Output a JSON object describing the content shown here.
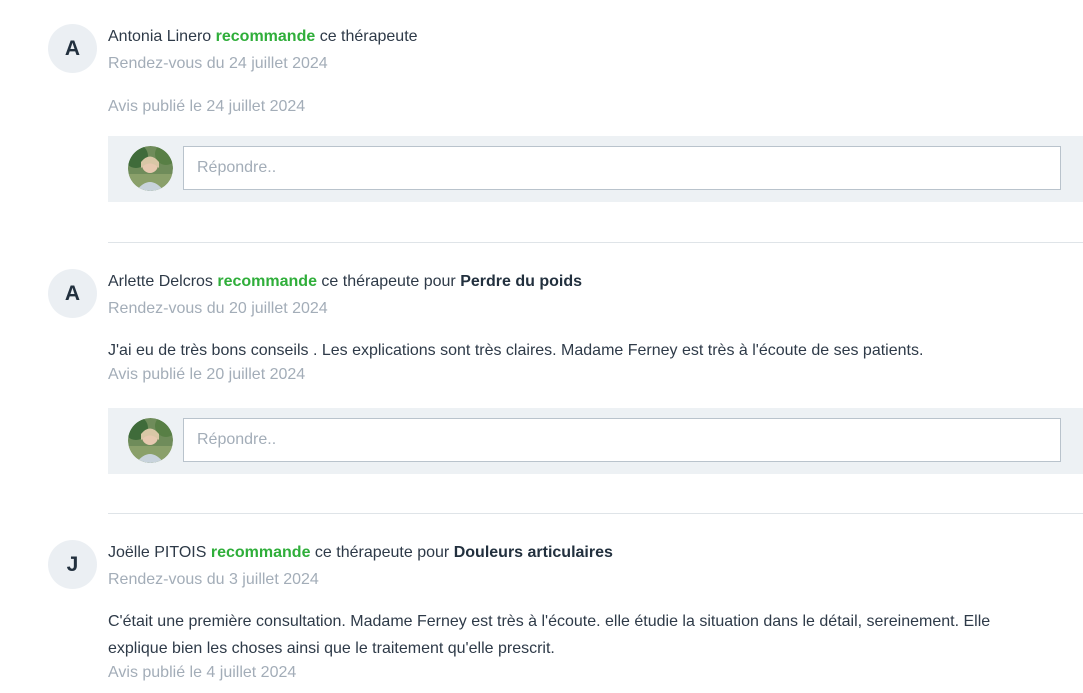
{
  "reviews": [
    {
      "initial": "A",
      "author": "Antonia Linero",
      "recommend_word": "recommande",
      "therapist_text": "ce thérapeute",
      "for_word": "",
      "reason": "",
      "appointment": "Rendez-vous du 24 juillet 2024",
      "text": "",
      "published": "Avis publié le 24 juillet 2024",
      "reply_placeholder": "Répondre.."
    },
    {
      "initial": "A",
      "author": "Arlette Delcros",
      "recommend_word": "recommande",
      "therapist_text": "ce thérapeute",
      "for_word": "pour",
      "reason": "Perdre du poids",
      "appointment": "Rendez-vous du 20 juillet 2024",
      "text": "J'ai eu de très bons conseils . Les explications sont très claires. Madame Ferney est très à l'écoute de ses patients.",
      "published": "Avis publié le 20 juillet 2024",
      "reply_placeholder": "Répondre.."
    },
    {
      "initial": "J",
      "author": "Joëlle PITOIS",
      "recommend_word": "recommande",
      "therapist_text": "ce thérapeute",
      "for_word": "pour",
      "reason": "Douleurs articulaires",
      "appointment": "Rendez-vous du 3 juillet 2024",
      "text": "C'était une première consultation. Madame Ferney est très à l'écoute. elle étudie la situation dans le détail, sereinement. Elle explique bien les choses ainsi que le traitement qu'elle prescrit.",
      "published": "Avis publié le 4 juillet 2024",
      "reply_placeholder": ""
    }
  ],
  "colors": {
    "recommend": "#2fae3a",
    "muted": "#a3adb8",
    "reply_bg": "#edf1f4",
    "avatar_bg": "#ebeff3"
  }
}
